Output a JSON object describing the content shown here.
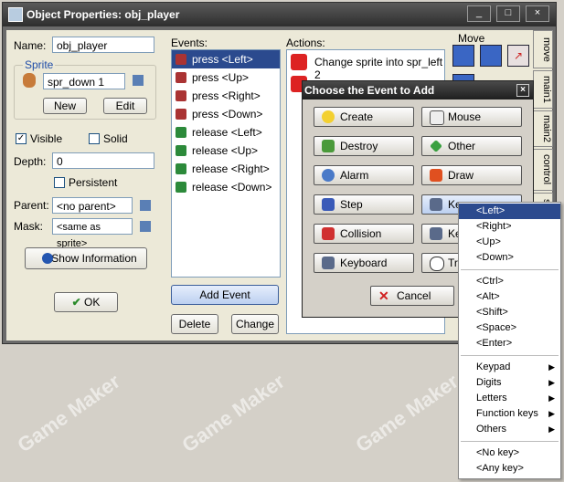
{
  "window": {
    "title": "Object Properties: obj_player",
    "min": "_",
    "max": "□",
    "close": "×"
  },
  "left": {
    "name_label": "Name:",
    "name_value": "obj_player",
    "sprite_group": "Sprite",
    "sprite_value": "spr_down 1",
    "new_btn": "New",
    "edit_btn": "Edit",
    "visible_label": "Visible",
    "solid_label": "Solid",
    "depth_label": "Depth:",
    "depth_value": "0",
    "persistent_label": "Persistent",
    "parent_label": "Parent:",
    "parent_value": "<no parent>",
    "mask_label": "Mask:",
    "mask_value": "<same as sprite>",
    "show_info": "Show Information",
    "ok_btn": "OK"
  },
  "events": {
    "label": "Events:",
    "items": [
      "press <Left>",
      "press <Up>",
      "press <Right>",
      "press <Down>",
      "release <Left>",
      "release <Up>",
      "release <Right>",
      "release <Down>"
    ],
    "add_event": "Add Event",
    "delete": "Delete",
    "change": "Change"
  },
  "actions": {
    "label": "Actions:",
    "items": [
      "Change sprite into spr_left 2"
    ]
  },
  "sidetabs": {
    "move_label": "Move",
    "tabs": [
      "move",
      "main1",
      "main2",
      "control",
      "sc"
    ]
  },
  "dialog": {
    "title": "Choose the Event to Add",
    "left_buttons": [
      "Create",
      "Destroy",
      "Alarm",
      "Step",
      "Collision",
      "Keyboard"
    ],
    "right_buttons": [
      "Mouse",
      "Other",
      "Draw",
      "Ke",
      "Ke",
      "Tr"
    ],
    "cancel": "Cancel"
  },
  "menu": {
    "group1": [
      "<Left>",
      "<Right>",
      "<Up>",
      "<Down>"
    ],
    "group2": [
      "<Ctrl>",
      "<Alt>",
      "<Shift>",
      "<Space>",
      "<Enter>"
    ],
    "group3": [
      "Keypad",
      "Digits",
      "Letters",
      "Function keys",
      "Others"
    ],
    "group4": [
      "<No key>",
      "<Any key>"
    ]
  },
  "watermark": "Game Maker",
  "colors": {
    "selection": "#2b4a8e",
    "title_bg": "#2e2e2e",
    "panel": "#ece9d8"
  }
}
